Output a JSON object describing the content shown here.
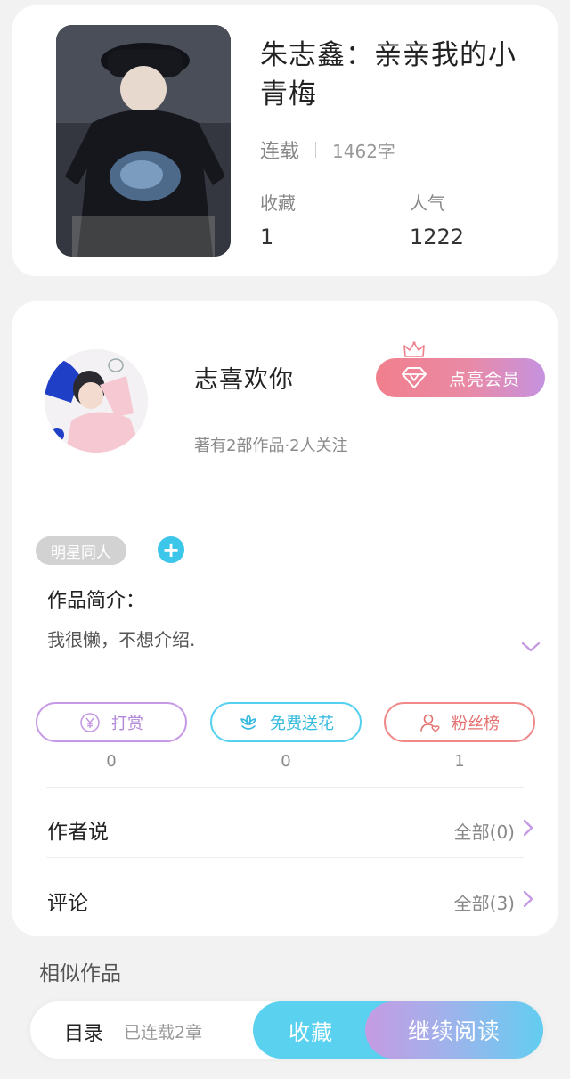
{
  "book": {
    "title": "朱志鑫：亲亲我的小青梅",
    "status": "连载",
    "word_count": "1462字",
    "favorites_label": "收藏",
    "favorites_value": "1",
    "popularity_label": "人气",
    "popularity_value": "1222"
  },
  "author": {
    "name": "志喜欢你",
    "info": "著有2部作品·2人关注",
    "vip_button": "点亮会员"
  },
  "work": {
    "tag": "明星同人",
    "add_tag_symbol": "+",
    "intro_label": "作品简介：",
    "intro_text": "我很懒，不想介绍."
  },
  "actions": [
    {
      "label": "打赏",
      "count": "0",
      "icon": "yen-coin-icon"
    },
    {
      "label": "免费送花",
      "count": "0",
      "icon": "flower-icon"
    },
    {
      "label": "粉丝榜",
      "count": "1",
      "icon": "fan-user-icon"
    }
  ],
  "rows": {
    "author_says_label": "作者说",
    "author_says_link": "全部(0)",
    "comments_label": "评论",
    "comments_link": "全部(3)"
  },
  "similar": {
    "title": "相似作品"
  },
  "bottom_bar": {
    "toc_label": "目录",
    "toc_count": "已连载2章",
    "favorite_button": "收藏",
    "continue_button": "继续阅读"
  },
  "colors": {
    "accent_cyan": "#5ad2ef",
    "accent_purple": "#c59be3",
    "vip_pink": "#f17f8c"
  }
}
